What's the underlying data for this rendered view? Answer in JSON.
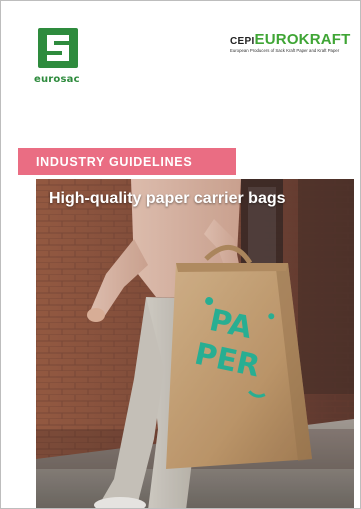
{
  "header": {
    "left_logo": {
      "name": "eurosac",
      "color": "#2e8b3d"
    },
    "right_logo": {
      "prefix": "CEPI",
      "name": "EUROKRAFT",
      "tagline": "European Producers of Sack Kraft Paper and Kraft Paper",
      "color": "#3fa535"
    }
  },
  "banner": {
    "label": "INDUSTRY GUIDELINES",
    "color": "#ea6d83"
  },
  "cover_photo": {
    "title": "High-quality paper carrier bags",
    "bag_print": "PAPER",
    "bag_print_color": "#2bb89a"
  }
}
